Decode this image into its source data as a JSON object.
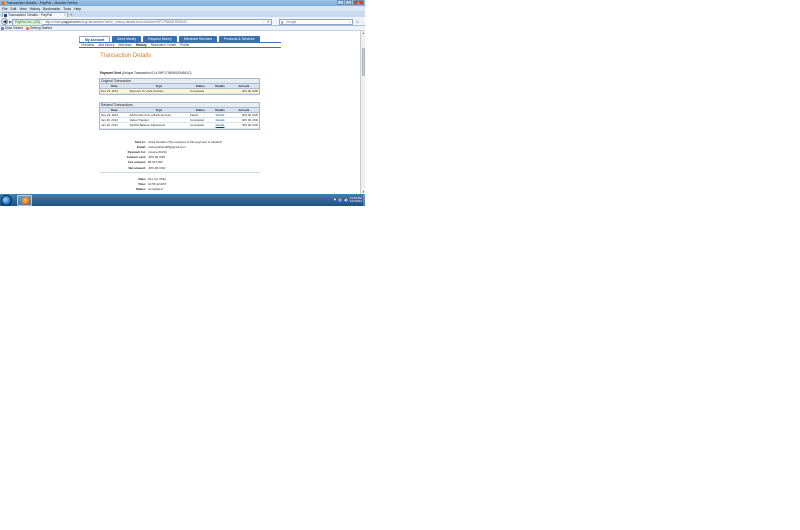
{
  "window": {
    "title": "Transaction Details - PayPal - Mozilla Firefox",
    "controls": {
      "minimize": "–",
      "maximize": "□",
      "close": "✕"
    }
  },
  "menu": [
    "File",
    "Edit",
    "View",
    "History",
    "Bookmarks",
    "Tools",
    "Help"
  ],
  "tab": {
    "title": "Transaction Details - PayPal",
    "close": "×",
    "new_tab": "+"
  },
  "nav": {
    "site_identity": "PayPal, Inc. (US)",
    "url_prefix": "https://www.",
    "url_domain": "paypal.com",
    "url_rest": "/us/cgi-bin/webscr?cmd=_history-details-from-hub&id=0HF17940M1934541C",
    "search_placeholder": "Google",
    "search_engine_letter": "g"
  },
  "bookmarks": [
    {
      "label": "Most Visited",
      "icon": "folder-icon"
    },
    {
      "label": "Getting Started",
      "icon": "rss-icon"
    }
  ],
  "paypal": {
    "main_tabs": [
      "My Account",
      "Send Money",
      "Request Money",
      "Merchant Services",
      "Products & Services"
    ],
    "active_main_tab": 0,
    "sub_nav": [
      "Overview",
      "Add Money",
      "Withdraw",
      "History",
      "Resolution Center",
      "Profile"
    ],
    "active_sub": 3,
    "page_title": "Transaction Details",
    "payment_sent_label": "Payment Sent",
    "payment_sent_value": "(Unique Transaction ID # 0HF17940M1934541C)",
    "original": {
      "title": "Original Transaction",
      "headers": [
        "Date",
        "Type",
        "Status",
        "Details",
        "Amount"
      ],
      "rows": [
        {
          "date": "Dec 23, 2012",
          "type": "Payment To Ursla Graham",
          "status": "Completed",
          "details": "",
          "amount": "-$70.00 USD"
        }
      ]
    },
    "related": {
      "title": "Related Transactions",
      "headers": [
        "Date",
        "Type",
        "Status",
        "Details",
        "Amount"
      ],
      "rows": [
        {
          "date": "Dec 23, 2012",
          "type": "Add Funds from a Bank Account",
          "status": "Failed",
          "details": "Details",
          "amount": "$70.00 USD"
        },
        {
          "date": "Jan 26, 2013",
          "type": "Failed Transfer",
          "status": "Completed",
          "details": "Details",
          "amount": "-$70.00 USD"
        },
        {
          "date": "Jan 26, 2013",
          "type": "PayPal Balance Adjustment",
          "status": "Completed",
          "details": "Details",
          "amount": "$70.00 USD"
        }
      ]
    },
    "details": [
      {
        "label": "Sent to:",
        "value": "Ursla Graham (The recipient of this payment is Verified)"
      },
      {
        "label": "Email:",
        "value": "ursla.graham68@gmail.com"
      },
      {
        "label": "Payment for:",
        "value": "Invoice #1234"
      },
      {
        "label": "Amount sent:",
        "value": "-$70.00 USD"
      },
      {
        "label": "Fee amount:",
        "value": "$0.00 USD"
      },
      {
        "label": "Net amount:",
        "value": "-$70.00 USD"
      }
    ],
    "details2": [
      {
        "label": "Date:",
        "value": "Dec 23, 2012"
      },
      {
        "label": "Time:",
        "value": "12:56:12 EST"
      },
      {
        "label": "Status:",
        "value": "Completed"
      }
    ]
  },
  "taskbar": {
    "clock_time": "11:15 AM",
    "clock_date": "1/21/2013"
  }
}
